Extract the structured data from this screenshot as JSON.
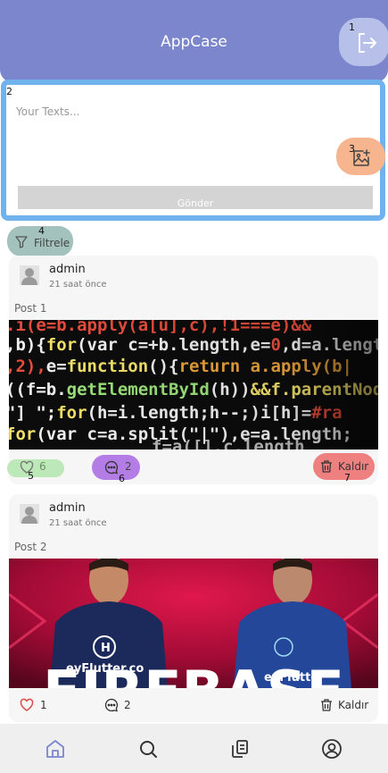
{
  "app": {
    "title": "AppCase"
  },
  "annotations": [
    "1",
    "2",
    "3",
    "4",
    "5",
    "6",
    "7"
  ],
  "icons": {
    "logout": "logout-icon",
    "image_add": "image-add-icon",
    "filter": "filter-icon",
    "like": "heart-icon",
    "comment": "comment-icon",
    "remove": "trash-icon",
    "nav": [
      "home-icon",
      "search-icon",
      "copy-icon",
      "profile-icon"
    ]
  },
  "composer": {
    "placeholder": "Your Texts...",
    "send_label": "Gönder"
  },
  "filter": {
    "label": "Filtrele"
  },
  "posts": [
    {
      "author": "admin",
      "time": "21 saat önce",
      "text": "Post 1",
      "image": "code-screen",
      "likes": "6",
      "comments": "2",
      "remove_label": "Kaldır"
    },
    {
      "author": "admin",
      "time": "21 saat önce",
      "text": "Post 2",
      "image": "firebase-banner",
      "image_caption": "FIREBASE",
      "image_tag": "eyFlutter.co",
      "likes": "1",
      "comments": "2",
      "remove_label": "Kaldır"
    }
  ],
  "colors": {
    "appbar": "#7b86cc",
    "composer_border": "#6fb2ee",
    "like_highlight": "#bde8b7",
    "comment_highlight": "#b47de6",
    "remove_highlight": "#ef8080",
    "filter_highlight": "#a3c2bd",
    "image_add_highlight": "#f6b48f",
    "active_nav": "#7b86cc"
  }
}
